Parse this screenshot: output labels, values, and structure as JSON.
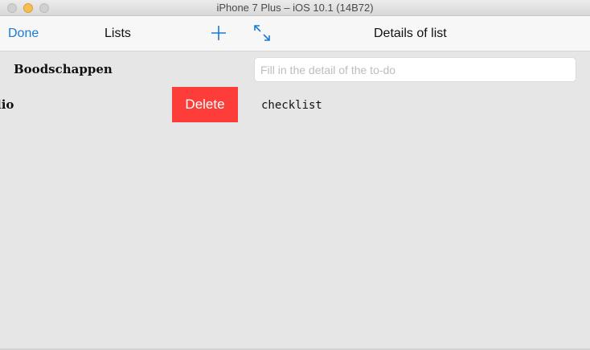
{
  "window": {
    "title": "iPhone 7 Plus – iOS 10.1 (14B72)"
  },
  "left_nav": {
    "done_label": "Done",
    "title": "Lists",
    "add_icon": "plus-icon"
  },
  "right_nav": {
    "expand_icon": "expand-arrows-icon",
    "title": "Details of list"
  },
  "lists": {
    "items": [
      {
        "label": "Boodschappen"
      },
      {
        "label": "lio",
        "delete_label": "Delete"
      }
    ]
  },
  "detail": {
    "input_placeholder": "Fill in the detail of the to-do",
    "input_value": "",
    "checklist_label": "checklist"
  },
  "colors": {
    "accent": "#1a7ad6",
    "delete": "#fc3d39",
    "background": "#e6e6e6",
    "navbar": "#f7f7f7"
  }
}
